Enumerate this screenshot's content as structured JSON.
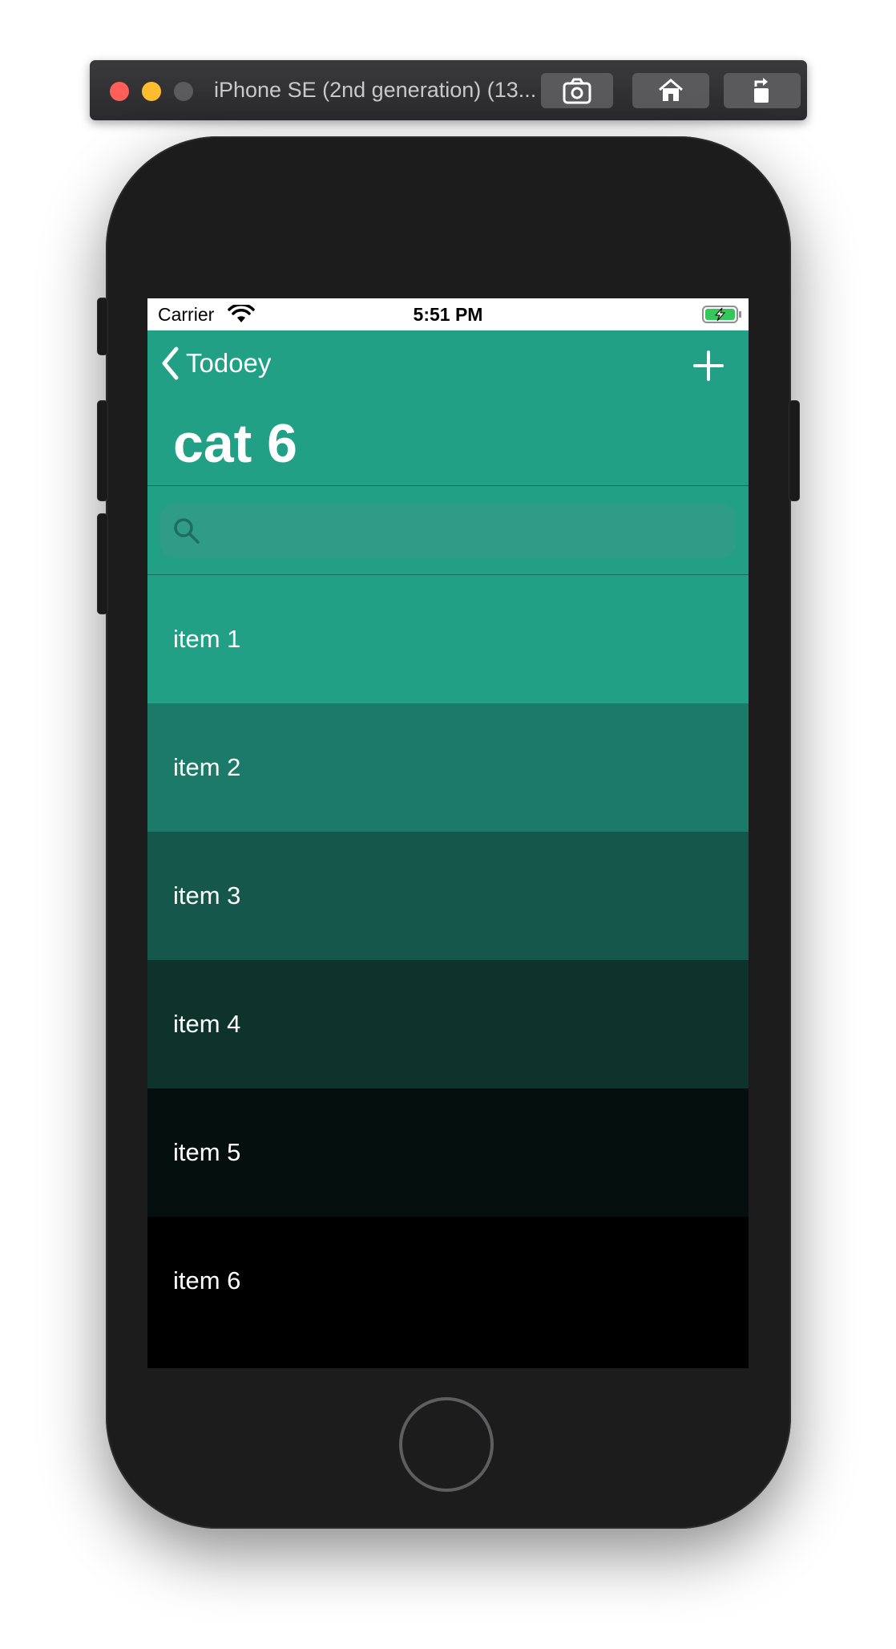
{
  "simulator": {
    "title": "iPhone SE (2nd generation) (13..."
  },
  "status_bar": {
    "carrier": "Carrier",
    "time": "5:51 PM"
  },
  "nav": {
    "back_label": "Todoey",
    "title": "cat 6",
    "add_icon": "plus-icon",
    "back_icon": "chevron-left-icon"
  },
  "search": {
    "placeholder": "",
    "icon": "magnifying-glass-icon"
  },
  "items": [
    {
      "label": "item 1",
      "color": "#22a085"
    },
    {
      "label": "item 2",
      "color": "#1c7b68"
    },
    {
      "label": "item 3",
      "color": "#15574a"
    },
    {
      "label": "item 4",
      "color": "#0d332b"
    },
    {
      "label": "item 5",
      "color": "#050f0d"
    },
    {
      "label": "item 6",
      "color": "#000000"
    }
  ],
  "colors": {
    "accent": "#22a085",
    "device_body": "#1c1c1d"
  }
}
